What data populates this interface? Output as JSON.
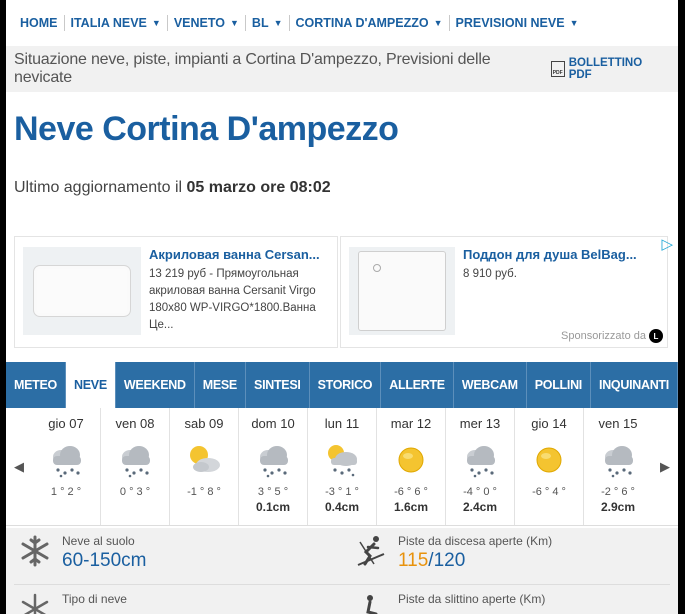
{
  "nav": {
    "items": [
      {
        "label": "HOME",
        "dropdown": false
      },
      {
        "label": "ITALIA NEVE",
        "dropdown": true
      },
      {
        "label": "VENETO",
        "dropdown": true
      },
      {
        "label": "BL",
        "dropdown": true
      },
      {
        "label": "CORTINA D'AMPEZZO",
        "dropdown": true
      },
      {
        "label": "PREVISIONI NEVE",
        "dropdown": true
      }
    ]
  },
  "header": {
    "subtitle": "Situazione neve, piste, impianti a Cortina D'ampezzo, Previsioni delle nevicate",
    "pdf_label": "BOLLETTINO PDF",
    "pdf_icon_text": "PDF"
  },
  "page": {
    "title": "Neve Cortina D'ampezzo",
    "updated_prefix": "Ultimo aggiornamento il",
    "updated_value": "05 marzo ore 08:02"
  },
  "ads": [
    {
      "title": "Акриловая ванна Cersan...",
      "desc": "13 219 руб - Прямоугольная акриловая ванна Cersanit Virgo 180x80 WP-VIRGO*1800.Ванна Це..."
    },
    {
      "title": "Поддон для душа BelBag...",
      "desc": "8 910 руб."
    }
  ],
  "ads_footer": {
    "sponsored": "Sponsorizzato da",
    "logo_letter": "L"
  },
  "tabs": [
    {
      "label": "METEO",
      "active": false
    },
    {
      "label": "NEVE",
      "active": true
    },
    {
      "label": "WEEKEND",
      "active": false
    },
    {
      "label": "MESE",
      "active": false
    },
    {
      "label": "SINTESI",
      "active": false
    },
    {
      "label": "STORICO",
      "active": false
    },
    {
      "label": "ALLERTE",
      "active": false
    },
    {
      "label": "WEBCAM",
      "active": false
    },
    {
      "label": "POLLINI",
      "active": false
    },
    {
      "label": "INQUINANTI",
      "active": false
    }
  ],
  "forecast": {
    "prev_icon": "chevron-left-icon",
    "next_icon": "chevron-right-icon",
    "days": [
      {
        "day": "gio 07",
        "icon": "cloud-snow-icon",
        "temp": "1 ° 2 °",
        "snow": ""
      },
      {
        "day": "ven 08",
        "icon": "cloud-snow-icon",
        "temp": "0 ° 3 °",
        "snow": ""
      },
      {
        "day": "sab 09",
        "icon": "sun-cloud-icon",
        "temp": "-1 ° 8 °",
        "snow": ""
      },
      {
        "day": "dom 10",
        "icon": "cloud-snow-icon",
        "temp": "3 ° 5 °",
        "snow": "0.1cm"
      },
      {
        "day": "lun 11",
        "icon": "sun-cloud-snow-icon",
        "temp": "-3 ° 1 °",
        "snow": "0.4cm"
      },
      {
        "day": "mar 12",
        "icon": "sun-icon",
        "temp": "-6 ° 6 °",
        "snow": "1.6cm"
      },
      {
        "day": "mer 13",
        "icon": "cloud-snow-icon",
        "temp": "-4 ° 0 °",
        "snow": "2.4cm"
      },
      {
        "day": "gio 14",
        "icon": "sun-icon",
        "temp": "-6 ° 4 °",
        "snow": ""
      },
      {
        "day": "ven 15",
        "icon": "cloud-snow-icon",
        "temp": "-2 ° 6 °",
        "snow": "2.9cm"
      }
    ]
  },
  "stats": {
    "snow_ground_label": "Neve al suolo",
    "snow_ground_value": "60-150cm",
    "slopes_label": "Piste da discesa aperte (Km)",
    "slopes_open": "115",
    "slopes_sep": "/",
    "slopes_total": "120",
    "snow_type_label": "Tipo di neve",
    "sled_label": "Piste da slittino aperte (Km)"
  },
  "colors": {
    "brand_blue": "#1a5fa0",
    "tab_bar": "#2c6ea5",
    "accent_orange": "#e8920c"
  }
}
